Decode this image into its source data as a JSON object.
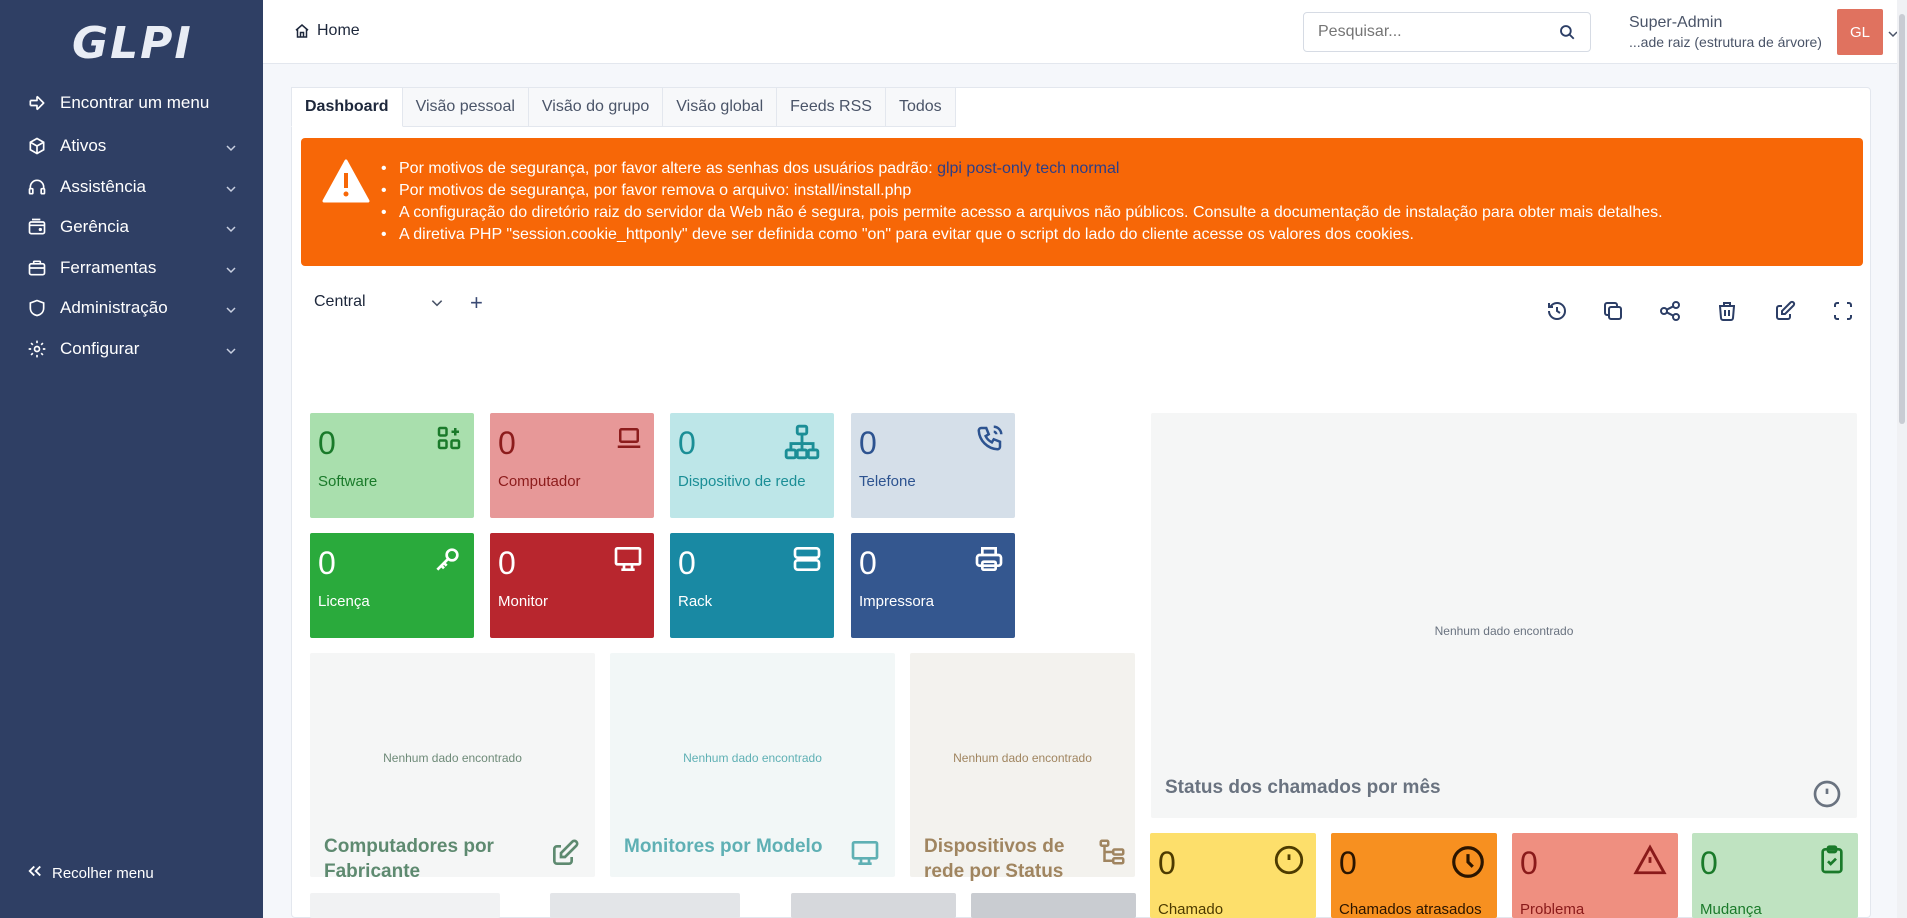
{
  "sidebar": {
    "logo": "GLPI",
    "items": [
      {
        "label": "Encontrar um menu",
        "icon": "arrow-right-icon"
      },
      {
        "label": "Ativos",
        "icon": "box-icon"
      },
      {
        "label": "Assistência",
        "icon": "headset-icon"
      },
      {
        "label": "Gerência",
        "icon": "wallet-icon"
      },
      {
        "label": "Ferramentas",
        "icon": "briefcase-icon"
      },
      {
        "label": "Administração",
        "icon": "shield-icon"
      },
      {
        "label": "Configurar",
        "icon": "gear-icon"
      }
    ],
    "collapse_label": "Recolher menu"
  },
  "header": {
    "breadcrumb": "Home",
    "search_placeholder": "Pesquisar...",
    "user_name": "Super-Admin",
    "user_entity": "...ade raiz (estrutura de árvore)",
    "avatar_initials": "GL"
  },
  "tabs": [
    {
      "label": "Dashboard",
      "active": true
    },
    {
      "label": "Visão pessoal",
      "active": false
    },
    {
      "label": "Visão do grupo",
      "active": false
    },
    {
      "label": "Visão global",
      "active": false
    },
    {
      "label": "Feeds RSS",
      "active": false
    },
    {
      "label": "Todos",
      "active": false
    }
  ],
  "alert": {
    "line1_text": "Por motivos de segurança, por favor altere as senhas dos usuários padrão: ",
    "line1_links": "glpi post-only tech normal",
    "line2": "Por motivos de segurança, por favor remova o arquivo: install/install.php",
    "line3": "A configuração do diretório raiz do servidor da Web não é segura, pois permite acesso a arquivos não públicos. Consulte a documentação de instalação para obter mais detalhes.",
    "line4": "A diretiva PHP \"session.cookie_httponly\" deve ser definida como \"on\" para evitar que o script do lado do cliente acesse os valores dos cookies."
  },
  "dashboard": {
    "selected": "Central",
    "add_symbol": "+"
  },
  "counters": [
    {
      "value": "0",
      "label": "Software",
      "icon": "apps-icon",
      "bg": "#a9dfad",
      "fg": "#1a7a2a"
    },
    {
      "value": "0",
      "label": "Computador",
      "icon": "laptop-icon",
      "bg": "#e79898",
      "fg": "#8c1c1c"
    },
    {
      "value": "0",
      "label": "Dispositivo de rede",
      "icon": "network-icon",
      "bg": "#bde6e8",
      "fg": "#1b8e96"
    },
    {
      "value": "0",
      "label": "Telefone",
      "icon": "phone-icon",
      "bg": "#d5dfe9",
      "fg": "#2d5390"
    },
    {
      "value": "0",
      "label": "Licença",
      "icon": "key-icon",
      "bg": "#2aaa3c",
      "fg": "#ffffff"
    },
    {
      "value": "0",
      "label": "Monitor",
      "icon": "monitor-icon",
      "bg": "#b8262e",
      "fg": "#ffffff"
    },
    {
      "value": "0",
      "label": "Rack",
      "icon": "server-icon",
      "bg": "#1989a3",
      "fg": "#ffffff"
    },
    {
      "value": "0",
      "label": "Impressora",
      "icon": "printer-icon",
      "bg": "#34578f",
      "fg": "#ffffff"
    }
  ],
  "widgets": [
    {
      "title": "Computadores por Fabricante",
      "nodata": "Nenhum dado encontrado",
      "icon": "edit-icon",
      "bg": "#f5f6f6",
      "fg": "#5e8a70"
    },
    {
      "title": "Monitores por Modelo",
      "nodata": "Nenhum dado encontrado",
      "icon": "monitor-icon",
      "bg": "#f2f7f7",
      "fg": "#5fb0b4"
    },
    {
      "title": "Dispositivos de rede por Status",
      "nodata": "Nenhum dado encontrado",
      "icon": "tree-icon",
      "bg": "#f3f2ee",
      "fg": "#a08560"
    }
  ],
  "status_widget": {
    "title": "Status dos chamados por mês",
    "nodata": "Nenhum dado encontrado",
    "icon": "alert-circle-icon"
  },
  "ticket_counters": [
    {
      "value": "0",
      "label": "Chamado",
      "icon": "alert-circle-icon",
      "bg": "#fddf6b",
      "fg": "#4d3b00"
    },
    {
      "value": "0",
      "label": "Chamados atrasados",
      "icon": "clock-icon",
      "bg": "#f79020",
      "fg": "#2a1500"
    },
    {
      "value": "0",
      "label": "Problema",
      "icon": "alert-triangle-icon",
      "bg": "#ef8f80",
      "fg": "#8a1a1a"
    },
    {
      "value": "0",
      "label": "Mudança",
      "icon": "clipboard-check-icon",
      "bg": "#bfe3c1",
      "fg": "#1a7a2a"
    }
  ]
}
